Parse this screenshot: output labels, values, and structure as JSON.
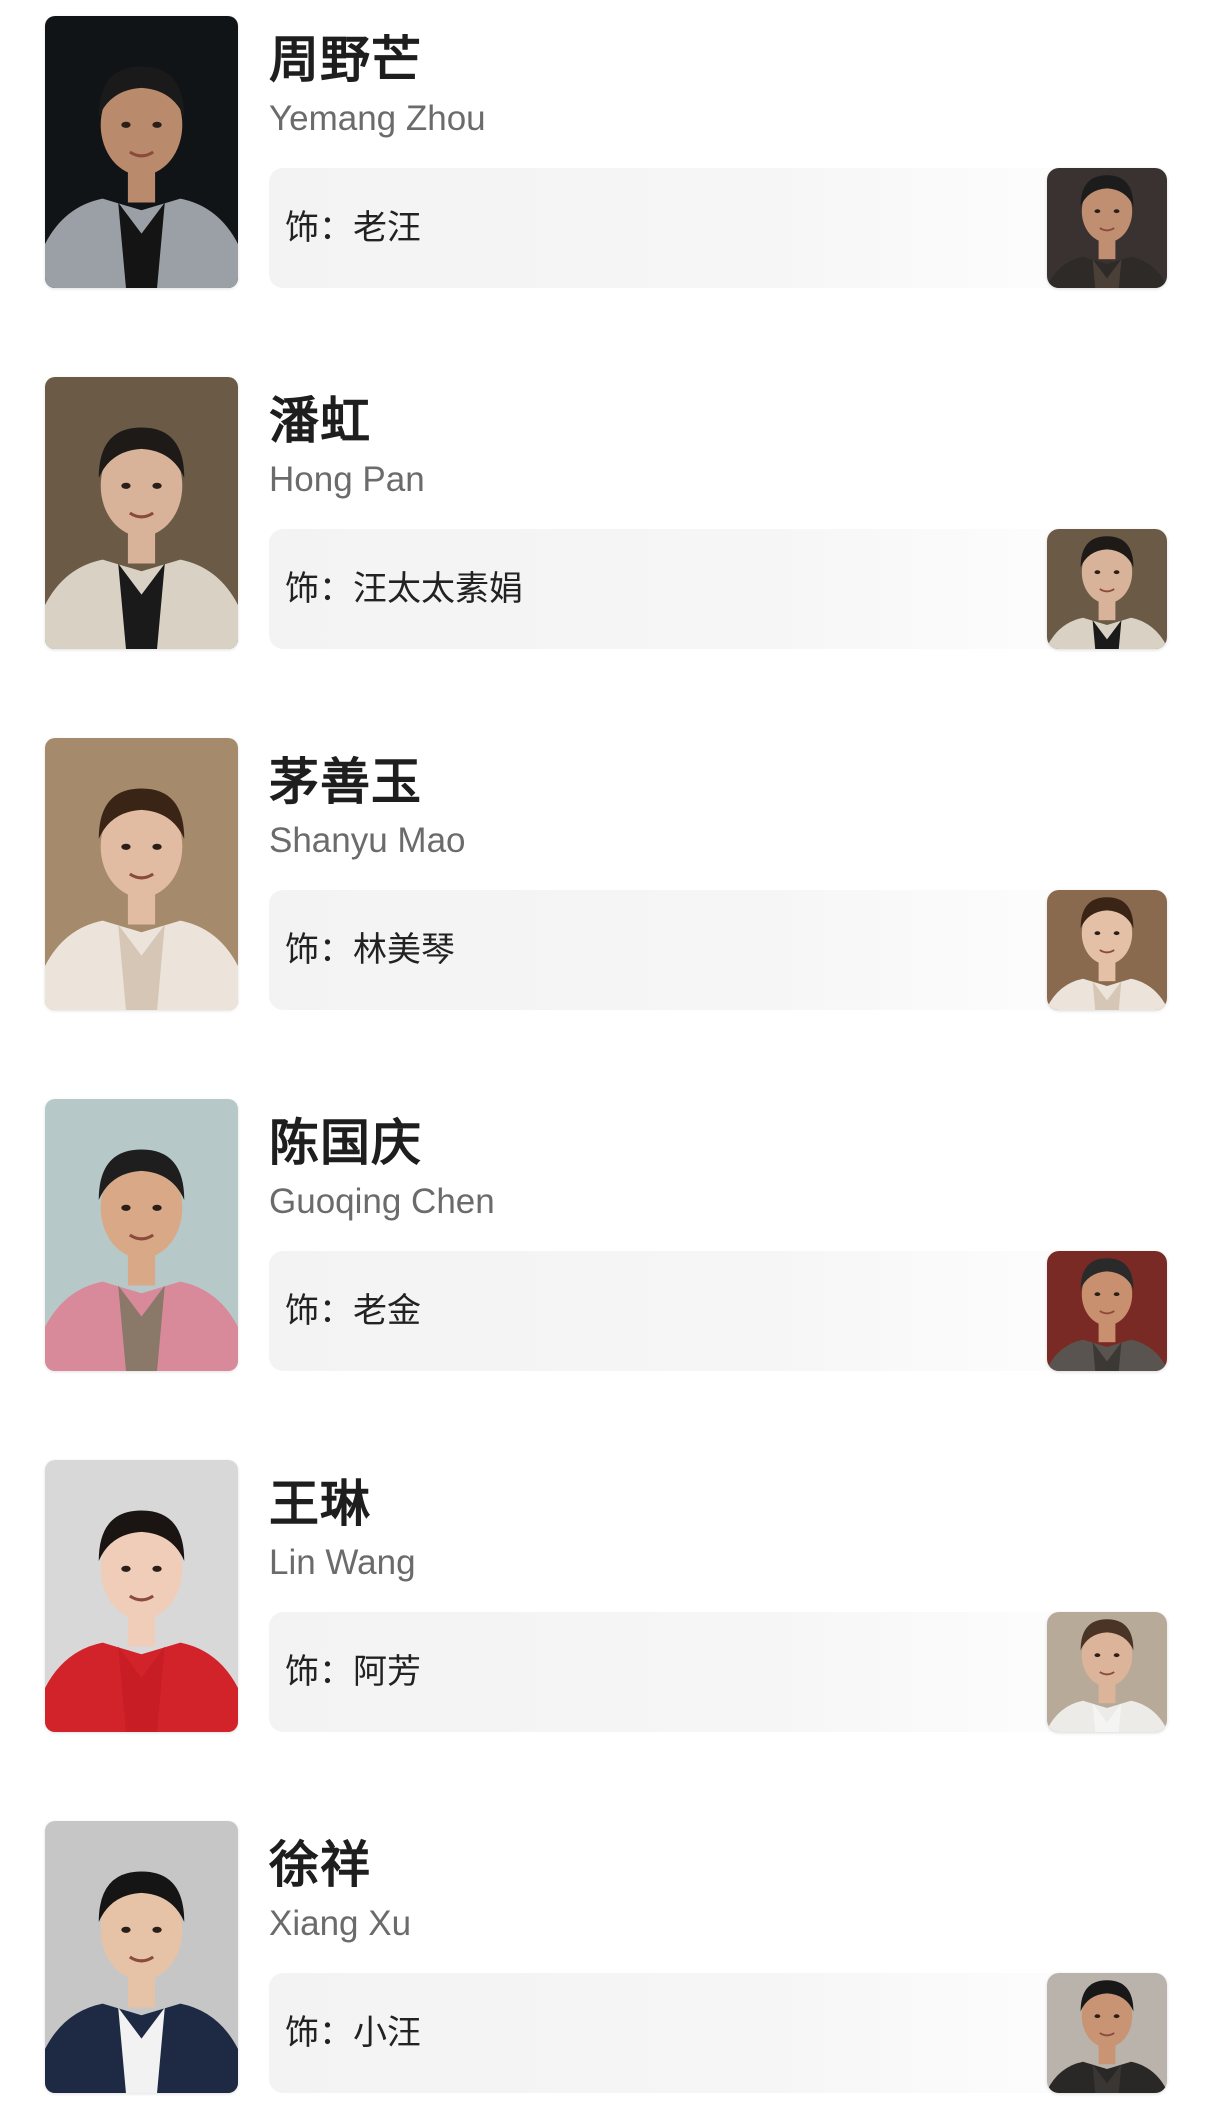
{
  "role_prefix": "饰：",
  "cast": [
    {
      "name": "周野芒",
      "name_en": "Yemang Zhou",
      "role": "老汪",
      "portrait": {
        "bg": "#111416",
        "skin": "#b98a6c",
        "hair": "#1a1a1a",
        "top": "#9aa0a6",
        "inner": "#141414"
      },
      "still": {
        "bg": "#3a3230",
        "skin": "#c08e70",
        "hair": "#1c1c1c",
        "top": "#2e2a28",
        "inner": "#4a4038"
      }
    },
    {
      "name": "潘虹",
      "name_en": "Hong Pan",
      "role": "汪太太素娟",
      "portrait": {
        "bg": "#6b5a46",
        "skin": "#d8b39a",
        "hair": "#1d1a18",
        "top": "#d9d2c4",
        "inner": "#1a1a1a"
      },
      "still": {
        "bg": "#6b5a46",
        "skin": "#d8b39a",
        "hair": "#1d1a18",
        "top": "#d9d2c4",
        "inner": "#1a1a1a"
      }
    },
    {
      "name": "茅善玉",
      "name_en": "Shanyu Mao",
      "role": "林美琴",
      "portrait": {
        "bg": "#a58a6c",
        "skin": "#e2bca2",
        "hair": "#3a2416",
        "top": "#ece4da",
        "inner": "#d6c6b6"
      },
      "still": {
        "bg": "#8a6a4e",
        "skin": "#e4c0a6",
        "hair": "#3a2416",
        "top": "#ece4da",
        "inner": "#d6c6b6"
      }
    },
    {
      "name": "陈国庆",
      "name_en": "Guoqing Chen",
      "role": "老金",
      "portrait": {
        "bg": "#b7c8c8",
        "skin": "#d9a886",
        "hair": "#1e1e1e",
        "top": "#d98a9a",
        "inner": "#8a7868"
      },
      "still": {
        "bg": "#7a2a24",
        "skin": "#c99070",
        "hair": "#2a2a2a",
        "top": "#5a5450",
        "inner": "#3c3834"
      }
    },
    {
      "name": "王琳",
      "name_en": "Lin Wang",
      "role": "阿芳",
      "portrait": {
        "bg": "#d8d8d8",
        "skin": "#efcdb8",
        "hair": "#1a1412",
        "top": "#d2232a",
        "inner": "#c91d26"
      },
      "still": {
        "bg": "#b8aa98",
        "skin": "#dcb49a",
        "hair": "#4a3426",
        "top": "#ecebe8",
        "inner": "#f4f4f2"
      }
    },
    {
      "name": "徐祥",
      "name_en": "Xiang Xu",
      "role": "小汪",
      "portrait": {
        "bg": "#c6c6c6",
        "skin": "#e6c2a6",
        "hair": "#151515",
        "top": "#1e2a44",
        "inner": "#f2f2f2"
      },
      "still": {
        "bg": "#b9b3ab",
        "skin": "#c99474",
        "hair": "#181818",
        "top": "#2a2826",
        "inner": "#3a3634"
      }
    }
  ]
}
